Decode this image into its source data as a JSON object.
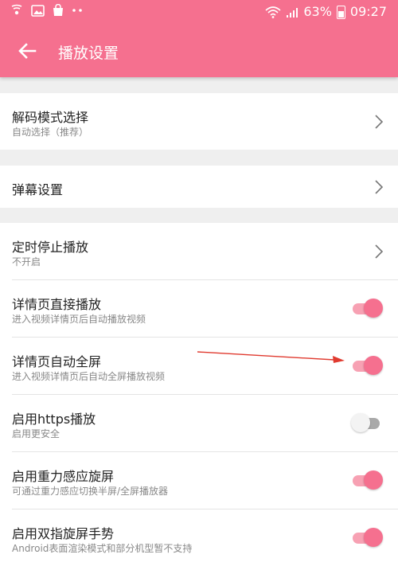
{
  "status_bar": {
    "battery": "63%",
    "time": "09:27",
    "icons": [
      "cast-icon",
      "image-icon",
      "shopping-bag-icon",
      "more-dots-icon",
      "wifi-icon",
      "signal-icon",
      "battery-icon"
    ]
  },
  "toolbar": {
    "title": "播放设置",
    "back_icon": "arrow-left-icon"
  },
  "sections": {
    "decode": {
      "title": "解码模式选择",
      "subtitle": "自动选择（推荐）"
    },
    "danmaku": {
      "title": "弹幕设置"
    },
    "timer": {
      "title": "定时停止播放",
      "subtitle": "不开启"
    },
    "direct_play": {
      "title": "详情页直接播放",
      "subtitle": "进入视频详情页后自动播放视频",
      "on": true
    },
    "auto_fullscreen": {
      "title": "详情页自动全屏",
      "subtitle": "进入视频详情页后自动全屏播放视频",
      "on": true
    },
    "https": {
      "title": "启用https播放",
      "subtitle": "启用更安全",
      "on": false
    },
    "gravity": {
      "title": "启用重力感应旋屏",
      "subtitle": "可通过重力感应切换半屏/全屏播放器",
      "on": true
    },
    "two_finger": {
      "title": "启用双指旋屏手势",
      "subtitle": "Android表面渲染模式和部分机型暂不支持",
      "on": true
    }
  },
  "colors": {
    "accent": "#f5708f",
    "track_on": "#f7a1b3",
    "track_off": "#a9a9a9",
    "annotation_arrow": "#e03a2f"
  }
}
